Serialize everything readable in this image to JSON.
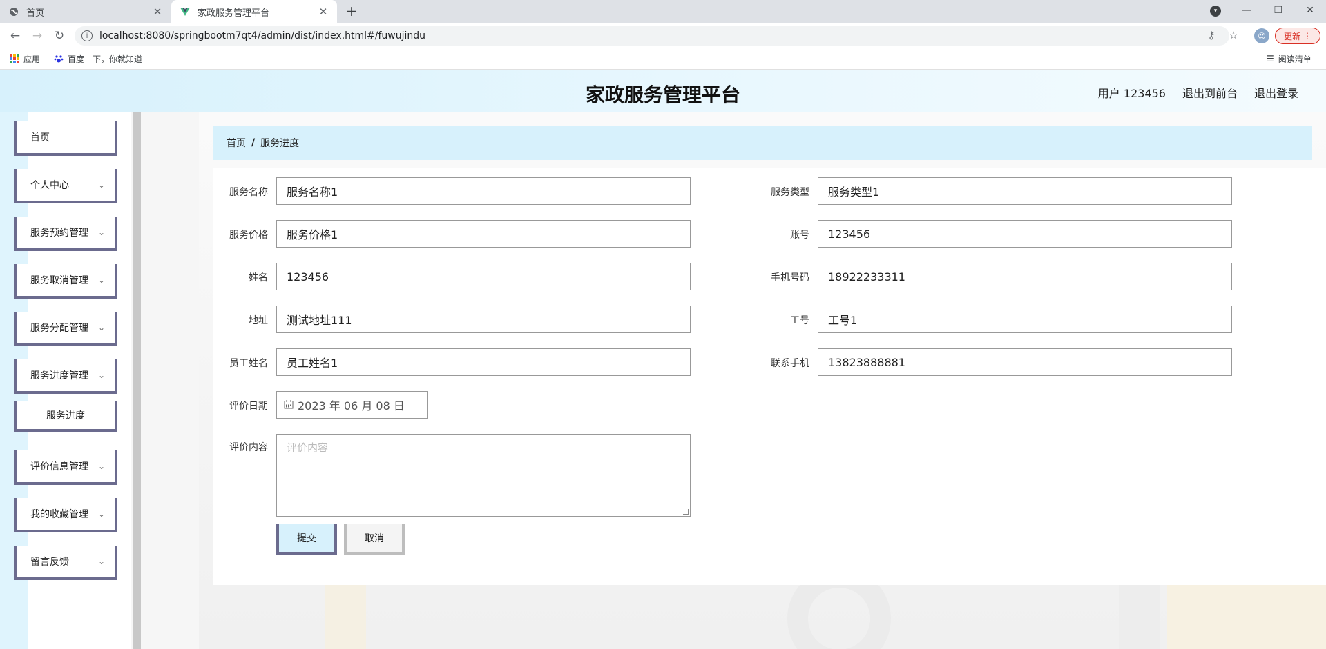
{
  "browser": {
    "tabs": [
      {
        "title": "首页",
        "icon": "globe-icon"
      },
      {
        "title": "家政服务管理平台",
        "icon": "vue-logo-icon"
      }
    ],
    "url": "localhost:8080/springbootm7qt4/admin/dist/index.html#/fuwujindu",
    "update_label": "更新",
    "bookmarks": {
      "apps": "应用",
      "baidu": "百度一下，你就知道",
      "reading_list": "阅读清单"
    }
  },
  "header": {
    "title": "家政服务管理平台",
    "user": "用户 123456",
    "back_front": "退出到前台",
    "logout": "退出登录"
  },
  "sidebar": {
    "items": [
      {
        "label": "首页",
        "expandable": false
      },
      {
        "label": "个人中心",
        "expandable": true
      },
      {
        "label": "服务预约管理",
        "expandable": true
      },
      {
        "label": "服务取消管理",
        "expandable": true
      },
      {
        "label": "服务分配管理",
        "expandable": true
      },
      {
        "label": "服务进度管理",
        "expandable": true
      },
      {
        "label": "服务进度",
        "sub": true
      },
      {
        "label": "评价信息管理",
        "expandable": true
      },
      {
        "label": "我的收藏管理",
        "expandable": true
      },
      {
        "label": "留言反馈",
        "expandable": true
      }
    ]
  },
  "breadcrumb": {
    "home": "首页",
    "separator": "/",
    "current": "服务进度"
  },
  "form": {
    "service_name": {
      "label": "服务名称",
      "value": "服务名称1"
    },
    "service_type": {
      "label": "服务类型",
      "value": "服务类型1"
    },
    "service_price": {
      "label": "服务价格",
      "value": "服务价格1"
    },
    "account": {
      "label": "账号",
      "value": "123456"
    },
    "name": {
      "label": "姓名",
      "value": "123456"
    },
    "phone": {
      "label": "手机号码",
      "value": "18922233311"
    },
    "address": {
      "label": "地址",
      "value": "测试地址111"
    },
    "employee_id": {
      "label": "工号",
      "value": "工号1"
    },
    "employee_name": {
      "label": "员工姓名",
      "value": "员工姓名1"
    },
    "contact_phone": {
      "label": "联系手机",
      "value": "13823888881"
    },
    "review_date": {
      "label": "评价日期",
      "value": "2023 年 06 月 08 日"
    },
    "review_content": {
      "label": "评价内容",
      "placeholder": "评价内容"
    },
    "submit_label": "提交",
    "cancel_label": "取消"
  },
  "colors": {
    "accent_light_blue": "#d7f1fc",
    "menu_border": "#6b6b8e",
    "update_red": "#d93025"
  }
}
